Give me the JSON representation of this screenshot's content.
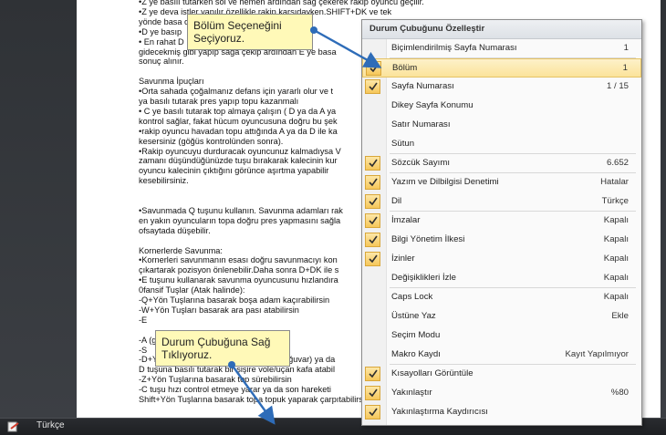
{
  "document": {
    "lines": [
      "•Z ye basılı tutarken sol ve hemen ardından sağ çekerek rakip oyuncu geçilir.",
      "•Z ye deva                              istler yapılır özellikle rakip karşıdayken.SHIFT+DK ve tek",
      "yönde basa                              ombinasyonları",
      "•D ye basıp",
      "• En rahat D",
      "gidecekmiş gibi yapıp sağa çekip ardından E ye basa",
      "sonuç alınır.",
      "",
      "Savunma İpuçları",
      "•Orta sahada çoğalmanız defans için yararlı olur ve t",
      "ya basılı tutarak pres yapıp topu kazanmalı",
      "• C ye basılı tutarak top almaya çalışın ( D ya  da A ya",
      "kontrol sağlar, fakat hücum oyuncusuna doğru bu şek",
      "•rakip oyuncu havadan topu attığında A ya da D ile ka",
      "kesersiniz (göğüs kontrolünden sonra).",
      "•Rakip oyuncuyu durduracak oyuncunuz kalmadıysa V",
      "zamanı düşündüğünüzde tuşu bırakarak kalecinin kur",
      "oyuncu kalecinin çıktığını görünce aşırtma yapabilir",
      "kesebilirsiniz.",
      "",
      "",
      "•Savunmada Q tuşunu kullanın. Savunma adamları rak",
      "en yakın oyuncuların topa doğru pres yapmasını sağla",
      "ofsaytada düşebilir.",
      "",
      "Kornerlerde Savunma:",
      "•Kornerleri savunmanın esası doğru savunmacıyı kon",
      "çıkartarak pozisyon önlenebilir.Daha sonra D+DK ile s",
      "•E tuşunu kullanarak savunma oyuncusunu hızlandıra",
      "0fansif Tuşlar (Atak halinde):",
      "-Q+Yön Tuşlarına basarak boşa adam kaçırabilirsin",
      "-W+Yön Tuşları basarak ara pası atabilirsin",
      "-E",
      "",
      "-A                                                                    (güç gösterg",
      "-S",
      "-D+Yön tuşlanyla şut çekebilir (güç çubuğuvar) ya da",
      "D tuşuna basılı tutarak bir şişire vole/uçan kafa atabil",
      "-Z+Yön Tuşlarına basarak top sürebilirsin",
      "-C tuşu hızı control etmeye yarar ya da son hareketi",
      "Shift+Yön Tuşlarına basarak topa topuk yaparak çarpıtabilirsiniz"
    ]
  },
  "callouts": {
    "top": "Bölüm Seçeneğini\nSeçiyoruz.",
    "bottom": "Durum Çubuğuna Sağ\nTıklıyoruz."
  },
  "statusbar": {
    "language": "Türkçe"
  },
  "menu": {
    "title": "Durum Çubuğunu Özelleştir",
    "items": [
      {
        "label": "Biçimlendirilmiş Sayfa Numarası",
        "value": "1",
        "checked": false
      },
      {
        "label": "Bölüm",
        "value": "1",
        "checked": true,
        "highlighted": true
      },
      {
        "label": "Sayfa Numarası",
        "value": "1 / 15",
        "checked": true
      },
      {
        "label": "Dikey Sayfa Konumu",
        "value": "",
        "checked": false
      },
      {
        "label": "Satır Numarası",
        "value": "",
        "checked": false
      },
      {
        "label": "Sütun",
        "value": "",
        "checked": false
      },
      {
        "label": "Sözcük Sayımı",
        "value": "6.652",
        "checked": true
      },
      {
        "label": "Yazım ve Dilbilgisi Denetimi",
        "value": "Hatalar",
        "checked": true
      },
      {
        "label": "Dil",
        "value": "Türkçe",
        "checked": true
      },
      {
        "label": "İmzalar",
        "value": "Kapalı",
        "checked": true
      },
      {
        "label": "Bilgi Yönetim İlkesi",
        "value": "Kapalı",
        "checked": true
      },
      {
        "label": "İzinler",
        "value": "Kapalı",
        "checked": true
      },
      {
        "label": "Değişiklikleri İzle",
        "value": "Kapalı",
        "checked": false
      },
      {
        "label": "Caps Lock",
        "value": "Kapalı",
        "checked": false
      },
      {
        "label": "Üstüne Yaz",
        "value": "Ekle",
        "checked": false
      },
      {
        "label": "Seçim Modu",
        "value": "",
        "checked": false
      },
      {
        "label": "Makro Kaydı",
        "value": "Kayıt Yapılmıyor",
        "checked": false
      },
      {
        "label": "Kısayolları Görüntüle",
        "value": "",
        "checked": true
      },
      {
        "label": "Yakınlaştır",
        "value": "%80",
        "checked": true
      },
      {
        "label": "Yakınlaştırma Kaydırıcısı",
        "value": "",
        "checked": true
      }
    ]
  },
  "colors": {
    "menu_highlight": "#fbe39a",
    "check_fill": "#f6c75a",
    "callout_fill": "#fff9b8",
    "arrow": "#2e6cb8"
  },
  "icons": [
    "check-icon",
    "status-bar-doc-icon",
    "callout-arrow-icon"
  ]
}
